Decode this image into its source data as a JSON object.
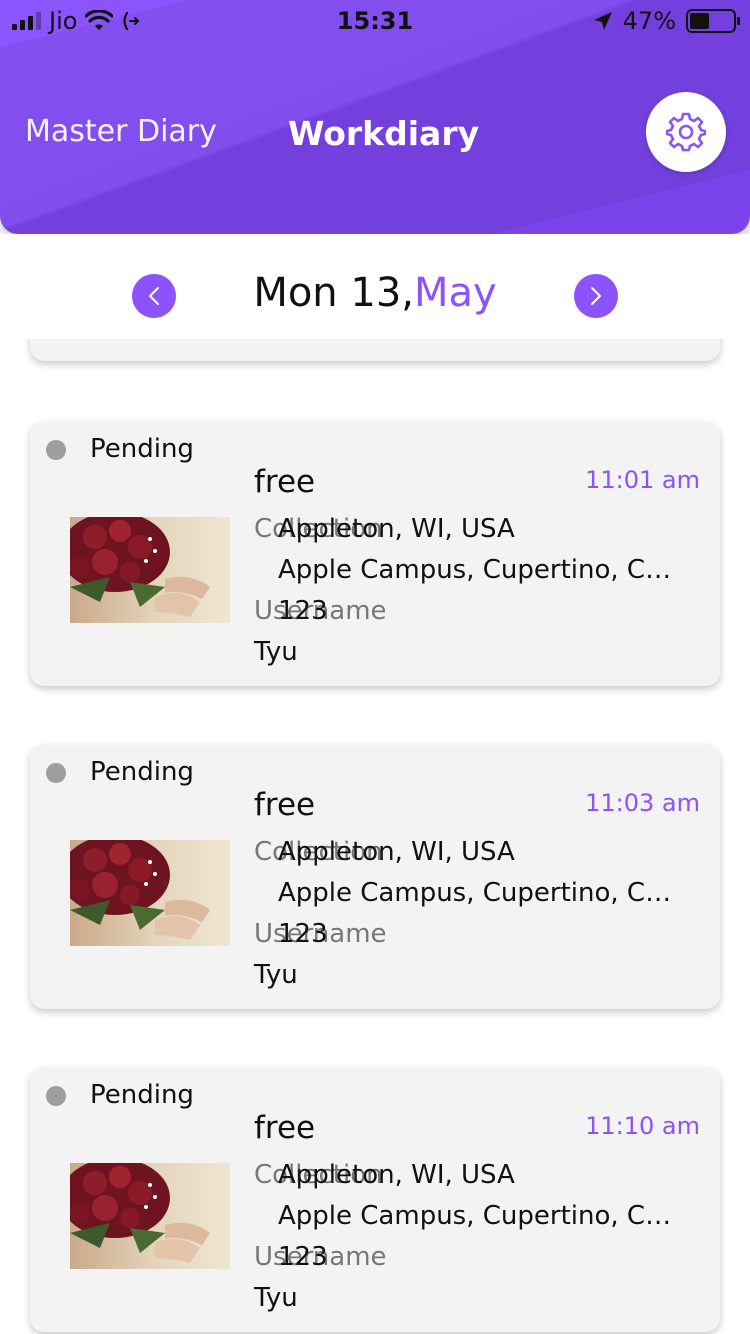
{
  "status_bar": {
    "carrier": "Jio",
    "time": "15:31",
    "battery": "47%"
  },
  "header": {
    "tab_master": "Master Diary",
    "tab_work": "Workdiary",
    "accent_color": "#8c53fb"
  },
  "date_bar": {
    "day_text": "Mon 13,",
    "month": "May"
  },
  "entries": [
    {
      "status": "Pending",
      "title": "free",
      "time": "11:01 am",
      "collection_label": "Collection",
      "city": "Appleton, WI, USA",
      "address": "Apple Campus, Cupertino, CA...",
      "username_label": "Username",
      "number": "123",
      "name": "Tyu"
    },
    {
      "status": "Pending",
      "title": "free",
      "time": "11:03 am",
      "collection_label": "Collection",
      "city": "Appleton, WI, USA",
      "address": "Apple Campus, Cupertino, CA...",
      "username_label": "Username",
      "number": "123",
      "name": "Tyu"
    },
    {
      "status": "Pending",
      "title": "free",
      "time": "11:10 am",
      "collection_label": "Collection",
      "city": "Appleton, WI, USA",
      "address": "Apple Campus, Cupertino, CA...",
      "username_label": "Username",
      "number": "123",
      "name": "Tyu"
    }
  ]
}
